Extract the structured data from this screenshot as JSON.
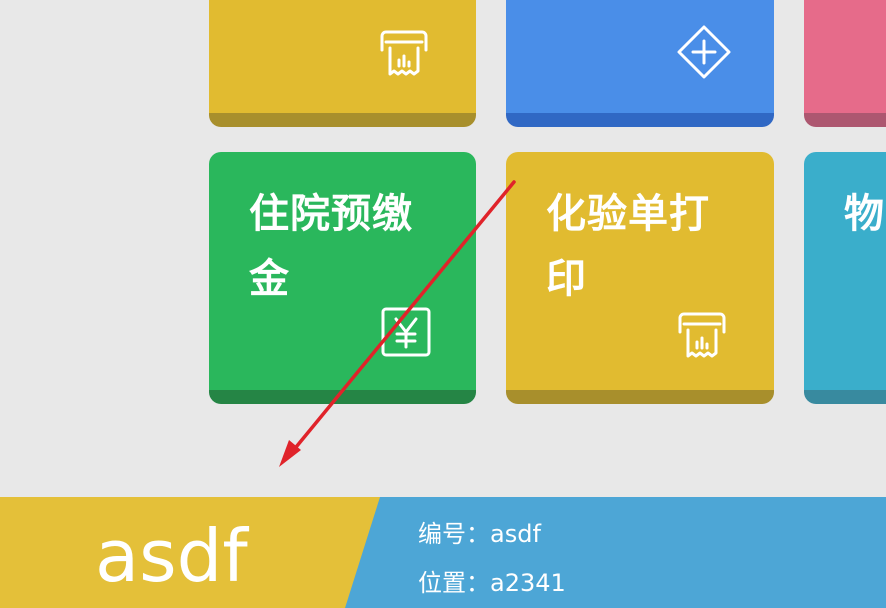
{
  "tiles": [
    {
      "id": "partial-yellow",
      "label": "",
      "icon": "receipt-print-icon"
    },
    {
      "id": "partial-blue",
      "label": "",
      "icon": "medical-cross-icon"
    },
    {
      "id": "partial-pink",
      "label": "",
      "icon": ""
    },
    {
      "id": "deposit",
      "label": "住院预缴金",
      "icon": "yen-icon"
    },
    {
      "id": "lab-print",
      "label": "化验单打印",
      "icon": "receipt-print-icon"
    },
    {
      "id": "partial-cyan",
      "label": "物",
      "icon": ""
    }
  ],
  "colors": {
    "yellow": "#e1bb30",
    "blue": "#4a8ee8",
    "pink": "#e66b8a",
    "green": "#2ab75c",
    "cyan": "#3aaecb",
    "arrow": "#e0232a",
    "footer_left": "#e4c039",
    "footer_right": "#4da6d6"
  },
  "footer": {
    "name": "asdf",
    "number_label": "编号：asdf",
    "location_label": "位置：a2341"
  }
}
